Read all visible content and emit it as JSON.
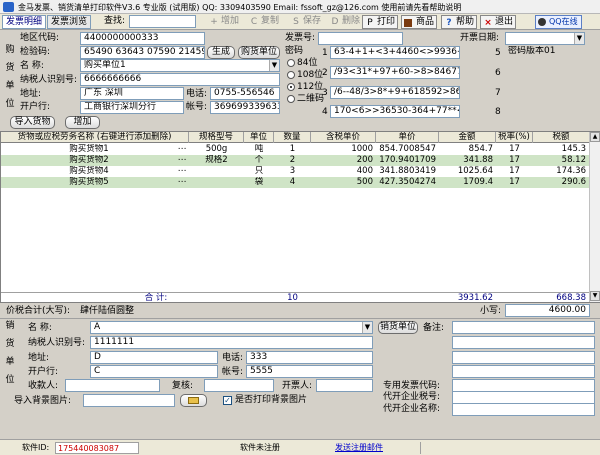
{
  "window": {
    "title": "金马发票、销货清单打印软件V3.6 专业版 (试用版)  QQ: 3309403590  Email: fssoft_gz@126.com 使用前请先看帮助说明"
  },
  "toolbar": {
    "tab_invoice": "发票明细",
    "tab_browse": "发票浏览",
    "search_label": "查找:",
    "search_value": "",
    "add": "增加",
    "copy": "复制",
    "save": "保存",
    "delete": "删除",
    "print": "打印",
    "goods": "商品",
    "help": "帮助",
    "exit": "退出",
    "qq": "QQ在线"
  },
  "buyer": {
    "section_label": [
      "购",
      "货",
      "单",
      "位"
    ],
    "area_code_label": "地区代码:",
    "area_code": "4400000000333",
    "check_code_label": "检验码:",
    "check_code": "65490 63643 07590 21459",
    "generate_btn": "生成",
    "name_label": "名    称:",
    "name": "购买单位1",
    "buyer_unit_btn": "购货单位",
    "tax_id_label": "纳税人识别号:",
    "tax_id": "6666666666",
    "address_label": "地址:",
    "address": "广东 深圳",
    "phone_label": "电话:",
    "phone": "0755-556546",
    "bank_label": "开户行:",
    "bank": "工商银行深圳分行",
    "account_label": "帐号:",
    "account": "369699339633",
    "import_btn": "导入货物",
    "add_btn": "增加"
  },
  "cipher": {
    "label": "密码",
    "options": [
      "84位",
      "108位",
      "112位",
      "二维码"
    ],
    "selected": "112位"
  },
  "invoice": {
    "number_label": "发票号:",
    "number": "",
    "date_label": "开票日期:",
    "date": "",
    "lines": [
      {
        "no": "1",
        "text": "63-4+1+<3+4460<>9936+1>2091"
      },
      {
        "no": "2",
        "text": "/93<31*+97+60->8>84677546051"
      },
      {
        "no": "3",
        "text": "/6--48/3>8*+9+618592>86>5796"
      },
      {
        "no": "4",
        "text": "170<6>>36530-364+77**<83>84/"
      }
    ],
    "side_labels": [
      "5",
      "6",
      "7",
      "8"
    ],
    "version_label": "密码版本01"
  },
  "table": {
    "headers": [
      "货物或应税劳务名称 (右键进行添加删除)",
      "规格型号",
      "单位",
      "数量",
      "含税单价",
      "单价",
      "金额",
      "税率(%)",
      "税额"
    ],
    "rows": [
      {
        "name": "购买货物1",
        "spec": "500g",
        "unit": "吨",
        "qty": "1",
        "tax_price": "1000",
        "price": "854.7008547",
        "amount": "854.7",
        "rate": "17",
        "tax": "145.3"
      },
      {
        "name": "购买货物2",
        "spec": "规格2",
        "unit": "个",
        "qty": "2",
        "tax_price": "200",
        "price": "170.9401709",
        "amount": "341.88",
        "rate": "17",
        "tax": "58.12"
      },
      {
        "name": "购买货物4",
        "spec": "",
        "unit": "只",
        "qty": "3",
        "tax_price": "400",
        "price": "341.8803419",
        "amount": "1025.64",
        "rate": "17",
        "tax": "174.36"
      },
      {
        "name": "购买货物5",
        "spec": "",
        "unit": "袋",
        "qty": "4",
        "tax_price": "500",
        "price": "427.3504274",
        "amount": "1709.4",
        "rate": "17",
        "tax": "290.6"
      }
    ],
    "total_label": "合 计:",
    "total_qty": "10",
    "total_amount": "3931.62",
    "total_tax": "668.38"
  },
  "summary": {
    "caps_label": "价税合计(大写):",
    "caps_value": "肆仟陆佰圆整",
    "small_label": "小写:",
    "small_value": "4600.00"
  },
  "seller": {
    "section_label": [
      "销",
      "货",
      "单",
      "位"
    ],
    "name_label": "名    称:",
    "name": "A",
    "seller_unit_btn": "销货单位",
    "tax_id_label": "纳税人识别号:",
    "tax_id": "1111111",
    "address_label": "地址:",
    "address": "D",
    "phone_label": "电话:",
    "phone": "333",
    "bank_label": "开户行:",
    "bank": "C",
    "account_label": "帐号:",
    "account": "5555",
    "remark_label": "备注:",
    "payee_label": "收款人:",
    "payee": "",
    "reviewer_label": "复核:",
    "reviewer": "",
    "drawer_label": "开票人:",
    "drawer": "",
    "import_bg_label": "导入背景图片:",
    "import_bg_value": "",
    "print_bg_label": "是否打印背景图片",
    "print_bg_checked": true,
    "special_code_label": "专用发票代码:",
    "agent_tax_id_label": "代开企业税号:",
    "agent_name_label": "代开企业名称:"
  },
  "statusbar": {
    "software_id_label": "软件ID:",
    "software_id": "175440083087",
    "reg_status": "软件未注册",
    "send_reg": "发送注册邮件"
  },
  "colors": {
    "alt_row": "#cfe4c6",
    "total_text": "#000080",
    "link": "#0000cc",
    "software_id": "#cc0000"
  }
}
